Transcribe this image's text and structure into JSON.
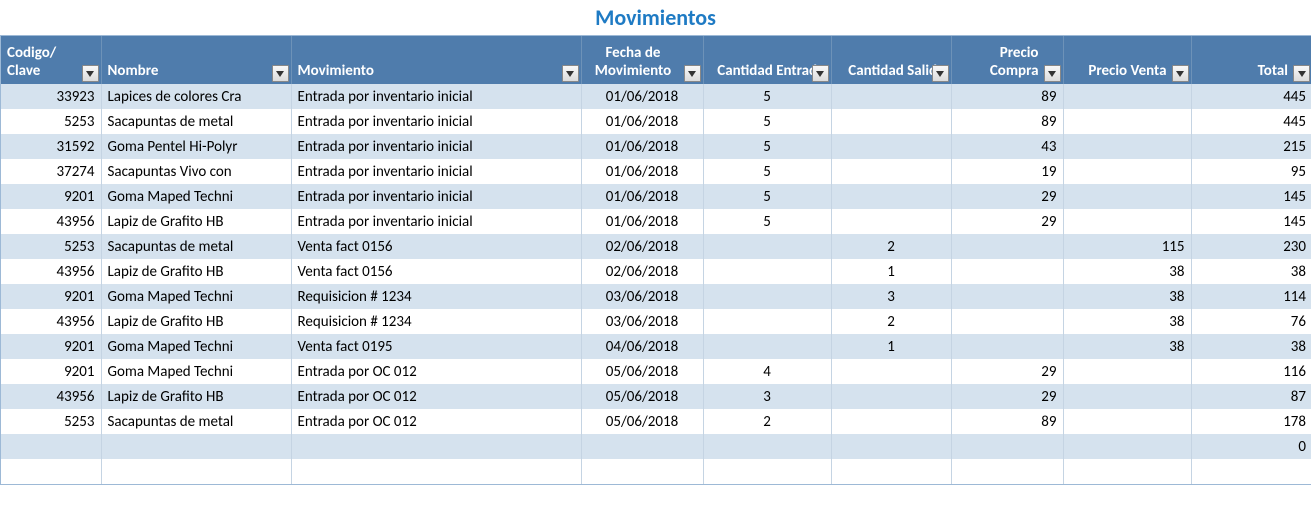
{
  "title": "Movimientos",
  "headers": {
    "codigo": "Codigo/ Clave",
    "nombre": "Nombre",
    "movimiento": "Movimiento",
    "fecha": "Fecha de Movimiento",
    "cant_entrada": "Cantidad Entrada",
    "cant_salida": "Cantidad Salida",
    "precio_compra": "Precio Compra",
    "precio_venta": "Precio Venta",
    "total": "Total"
  },
  "rows": [
    {
      "codigo": "33923",
      "nombre": "Lapices de colores Cra",
      "movimiento": "Entrada por inventario inicial",
      "fecha": "01/06/2018",
      "cant_entrada": "5",
      "cant_salida": "",
      "precio_compra": "89",
      "precio_venta": "",
      "total": "445"
    },
    {
      "codigo": "5253",
      "nombre": "Sacapuntas de metal",
      "movimiento": "Entrada por inventario inicial",
      "fecha": "01/06/2018",
      "cant_entrada": "5",
      "cant_salida": "",
      "precio_compra": "89",
      "precio_venta": "",
      "total": "445"
    },
    {
      "codigo": "31592",
      "nombre": "Goma Pentel Hi-Polyr",
      "movimiento": "Entrada por inventario inicial",
      "fecha": "01/06/2018",
      "cant_entrada": "5",
      "cant_salida": "",
      "precio_compra": "43",
      "precio_venta": "",
      "total": "215"
    },
    {
      "codigo": "37274",
      "nombre": "Sacapuntas Vivo con",
      "movimiento": "Entrada por inventario inicial",
      "fecha": "01/06/2018",
      "cant_entrada": "5",
      "cant_salida": "",
      "precio_compra": "19",
      "precio_venta": "",
      "total": "95"
    },
    {
      "codigo": "9201",
      "nombre": "Goma Maped Techni",
      "movimiento": "Entrada por inventario inicial",
      "fecha": "01/06/2018",
      "cant_entrada": "5",
      "cant_salida": "",
      "precio_compra": "29",
      "precio_venta": "",
      "total": "145"
    },
    {
      "codigo": "43956",
      "nombre": "Lapiz de Grafito HB",
      "movimiento": "Entrada por inventario inicial",
      "fecha": "01/06/2018",
      "cant_entrada": "5",
      "cant_salida": "",
      "precio_compra": "29",
      "precio_venta": "",
      "total": "145"
    },
    {
      "codigo": "5253",
      "nombre": "Sacapuntas de metal",
      "movimiento": "Venta fact 0156",
      "fecha": "02/06/2018",
      "cant_entrada": "",
      "cant_salida": "2",
      "precio_compra": "",
      "precio_venta": "115",
      "total": "230"
    },
    {
      "codigo": "43956",
      "nombre": "Lapiz de Grafito HB",
      "movimiento": "Venta fact 0156",
      "fecha": "02/06/2018",
      "cant_entrada": "",
      "cant_salida": "1",
      "precio_compra": "",
      "precio_venta": "38",
      "total": "38"
    },
    {
      "codigo": "9201",
      "nombre": "Goma Maped Techni",
      "movimiento": "Requisicion # 1234",
      "fecha": "03/06/2018",
      "cant_entrada": "",
      "cant_salida": "3",
      "precio_compra": "",
      "precio_venta": "38",
      "total": "114"
    },
    {
      "codigo": "43956",
      "nombre": "Lapiz de Grafito HB",
      "movimiento": "Requisicion # 1234",
      "fecha": "03/06/2018",
      "cant_entrada": "",
      "cant_salida": "2",
      "precio_compra": "",
      "precio_venta": "38",
      "total": "76"
    },
    {
      "codigo": "9201",
      "nombre": "Goma Maped Techni",
      "movimiento": "Venta fact 0195",
      "fecha": "04/06/2018",
      "cant_entrada": "",
      "cant_salida": "1",
      "precio_compra": "",
      "precio_venta": "38",
      "total": "38"
    },
    {
      "codigo": "9201",
      "nombre": "Goma Maped Techni",
      "movimiento": "Entrada por OC 012",
      "fecha": "05/06/2018",
      "cant_entrada": "4",
      "cant_salida": "",
      "precio_compra": "29",
      "precio_venta": "",
      "total": "116"
    },
    {
      "codigo": "43956",
      "nombre": "Lapiz de Grafito HB",
      "movimiento": "Entrada por OC 012",
      "fecha": "05/06/2018",
      "cant_entrada": "3",
      "cant_salida": "",
      "precio_compra": "29",
      "precio_venta": "",
      "total": "87"
    },
    {
      "codigo": "5253",
      "nombre": "Sacapuntas de metal",
      "movimiento": "Entrada por OC 012",
      "fecha": "05/06/2018",
      "cant_entrada": "2",
      "cant_salida": "",
      "precio_compra": "89",
      "precio_venta": "",
      "total": "178"
    },
    {
      "codigo": "",
      "nombre": "",
      "movimiento": "",
      "fecha": "",
      "cant_entrada": "",
      "cant_salida": "",
      "precio_compra": "",
      "precio_venta": "",
      "total": "0"
    },
    {
      "codigo": "",
      "nombre": "",
      "movimiento": "",
      "fecha": "",
      "cant_entrada": "",
      "cant_salida": "",
      "precio_compra": "",
      "precio_venta": "",
      "total": ""
    }
  ]
}
